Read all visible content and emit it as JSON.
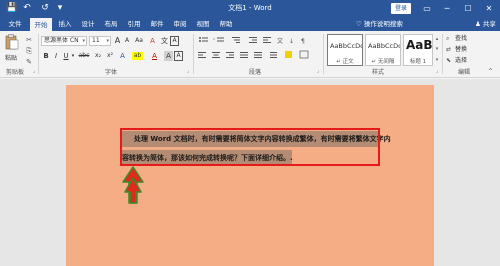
{
  "titlebar": {
    "doc_title": "文档1 - Word",
    "login_label": "登录",
    "save_icon": "💾",
    "undo_icon": "↶",
    "redo_icon": "↺",
    "customize_icon": "▾",
    "layout_icon": "▭",
    "minimize_icon": "─",
    "maximize_icon": "☐",
    "close_icon": "✕"
  },
  "tabs": [
    {
      "label": "文件"
    },
    {
      "label": "开始"
    },
    {
      "label": "插入"
    },
    {
      "label": "设计"
    },
    {
      "label": "布局"
    },
    {
      "label": "引用"
    },
    {
      "label": "邮件"
    },
    {
      "label": "审阅"
    },
    {
      "label": "视图"
    },
    {
      "label": "帮助"
    }
  ],
  "tell_me": "♡ 操作说明搜索",
  "share": "♟ 共享",
  "ribbon": {
    "clipboard": {
      "paste_label": "粘贴",
      "group_label": "剪贴板",
      "cut_icon": "✂",
      "copy_icon": "⎘",
      "format_painter_icon": "✎"
    },
    "font": {
      "font_name": "思源黑体 CN",
      "font_size": "11",
      "grow_font": "A",
      "shrink_font": "A",
      "change_case": "Aa",
      "clear_format": "A",
      "bold": "B",
      "italic": "I",
      "underline": "U",
      "strikethrough": "abc",
      "subscript": "x₂",
      "superscript": "x²",
      "text_effects": "A",
      "highlight": "ab",
      "font_color": "A",
      "char_shading": "A",
      "group_label": "字体"
    },
    "paragraph": {
      "group_label": "段落"
    },
    "styles": {
      "items": [
        {
          "sample": "AaBbCcDc",
          "name": "↵ 正文"
        },
        {
          "sample": "AaBbCcDc",
          "name": "↵ 无间隔"
        },
        {
          "sample": "AaBl",
          "name": "标题 1"
        }
      ],
      "group_label": "样式"
    },
    "editing": {
      "find": "查找",
      "replace": "替换",
      "select": "选择",
      "group_label": "编辑"
    }
  },
  "document": {
    "line1": "处理 Word 文档时，有时需要将简体文字内容转换成繁体，有时需要将繁体文字内",
    "line2": "容转换为简体，那该如何完成转换呢？下面详细介绍。."
  },
  "colors": {
    "accent": "#2b579a",
    "page": "#f4ad84",
    "selection": "#b48c74",
    "highlight_frame": "#e51a1a",
    "arrow_fill": "#e02a1a",
    "arrow_stroke": "#3c8a2a"
  }
}
